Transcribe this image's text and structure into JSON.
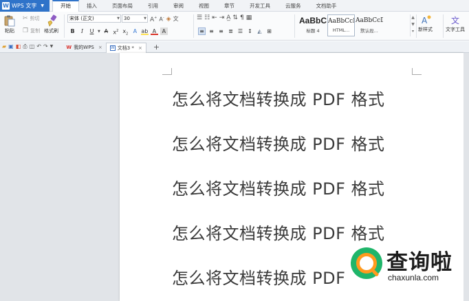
{
  "app": {
    "logo": "W",
    "name": "WPS 文字",
    "accent_color": "#2f73c9"
  },
  "menu": {
    "tabs": [
      "开始",
      "插入",
      "页面布局",
      "引用",
      "审阅",
      "视图",
      "章节",
      "开发工具",
      "云服务",
      "文档助手"
    ],
    "active_index": 0
  },
  "ribbon": {
    "paste_label": "粘贴",
    "cut_label": "剪切",
    "copy_label": "复制",
    "format_painter_label": "格式刷",
    "font_name": "宋体 (正文)",
    "font_size": "30",
    "styles": [
      {
        "sample": "AaBbC",
        "name": "标题 4"
      },
      {
        "sample": "AaBbCcDd",
        "name": "HTML..."
      },
      {
        "sample": "AaBbCcDd",
        "name": "默认段..."
      }
    ],
    "new_style_label": "新样式",
    "text_tools_label": "文字工具"
  },
  "doc_tabs": [
    {
      "icon": "wps-icon",
      "label": "我的WPS",
      "close": "×"
    },
    {
      "icon": "document-icon",
      "label": "文档3 *",
      "close": "×"
    }
  ],
  "new_tab_symbol": "+",
  "document": {
    "lines": [
      "怎么将文档转换成 PDF 格式",
      "怎么将文档转换成 PDF 格式",
      "怎么将文档转换成 PDF 格式",
      "怎么将文档转换成 PDF 格式",
      "怎么将文档转换成 PDF"
    ]
  },
  "watermark": {
    "title": "查询啦",
    "url": "chaxunla.com"
  }
}
